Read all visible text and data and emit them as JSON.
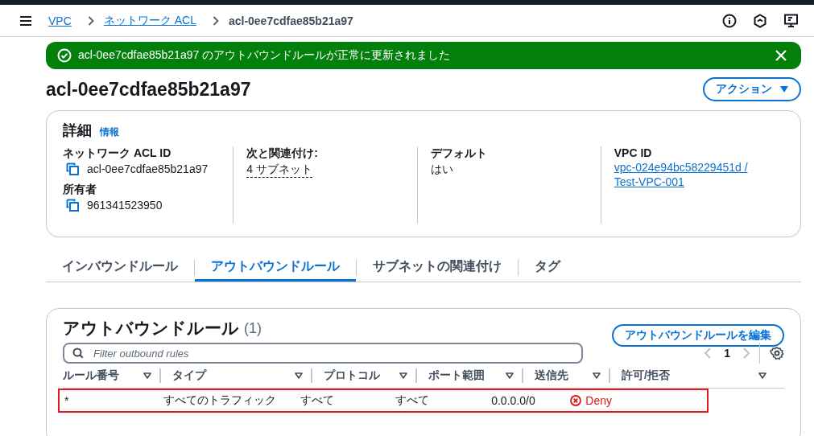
{
  "breadcrumbs": [
    {
      "label": "VPC",
      "link": true
    },
    {
      "label": "ネットワーク ACL",
      "link": true
    },
    {
      "label": "acl-0ee7cdfae85b21a97",
      "link": false
    }
  ],
  "flash": {
    "message": "acl-0ee7cdfae85b21a97 のアウトバウンドルールが正常に更新されました"
  },
  "page_title": "acl-0ee7cdfae85b21a97",
  "actions_button": "アクション",
  "details": {
    "title": "詳細",
    "info_link": "情報",
    "columns": [
      [
        {
          "label": "ネットワーク ACL ID",
          "value": "acl-0ee7cdfae85b21a97",
          "kind": "copy"
        },
        {
          "label": "所有者",
          "value": "961341523950",
          "kind": "copy"
        }
      ],
      [
        {
          "label": "次と関連付け:",
          "value": "4 サブネット",
          "kind": "popover"
        }
      ],
      [
        {
          "label": "デフォルト",
          "value": "はい",
          "kind": "plain"
        }
      ],
      [
        {
          "label": "VPC ID",
          "value": "vpc-024e94bc58229451d /",
          "value2": "Test-VPC-001",
          "kind": "link"
        }
      ]
    ]
  },
  "tabs": [
    {
      "label": "インバウンドルール",
      "selected": false
    },
    {
      "label": "アウトバウンドルール",
      "selected": true
    },
    {
      "label": "サブネットの関連付け",
      "selected": false
    },
    {
      "label": "タグ",
      "selected": false
    }
  ],
  "rules_table": {
    "title": "アウトバウンドルール",
    "count": "(1)",
    "edit_button": "アウトバウンドルールを編集",
    "search": {
      "placeholder": "Filter outbound rules"
    },
    "page": "1",
    "columns": [
      "ルール番号",
      "タイプ",
      "プロトコル",
      "ポート範囲",
      "送信先",
      "許可/拒否"
    ],
    "rows": [
      {
        "cells": [
          "*",
          "すべてのトラフィック",
          "すべて",
          "すべて",
          "0.0.0.0/0",
          "Deny"
        ],
        "highlighted": true
      }
    ]
  }
}
